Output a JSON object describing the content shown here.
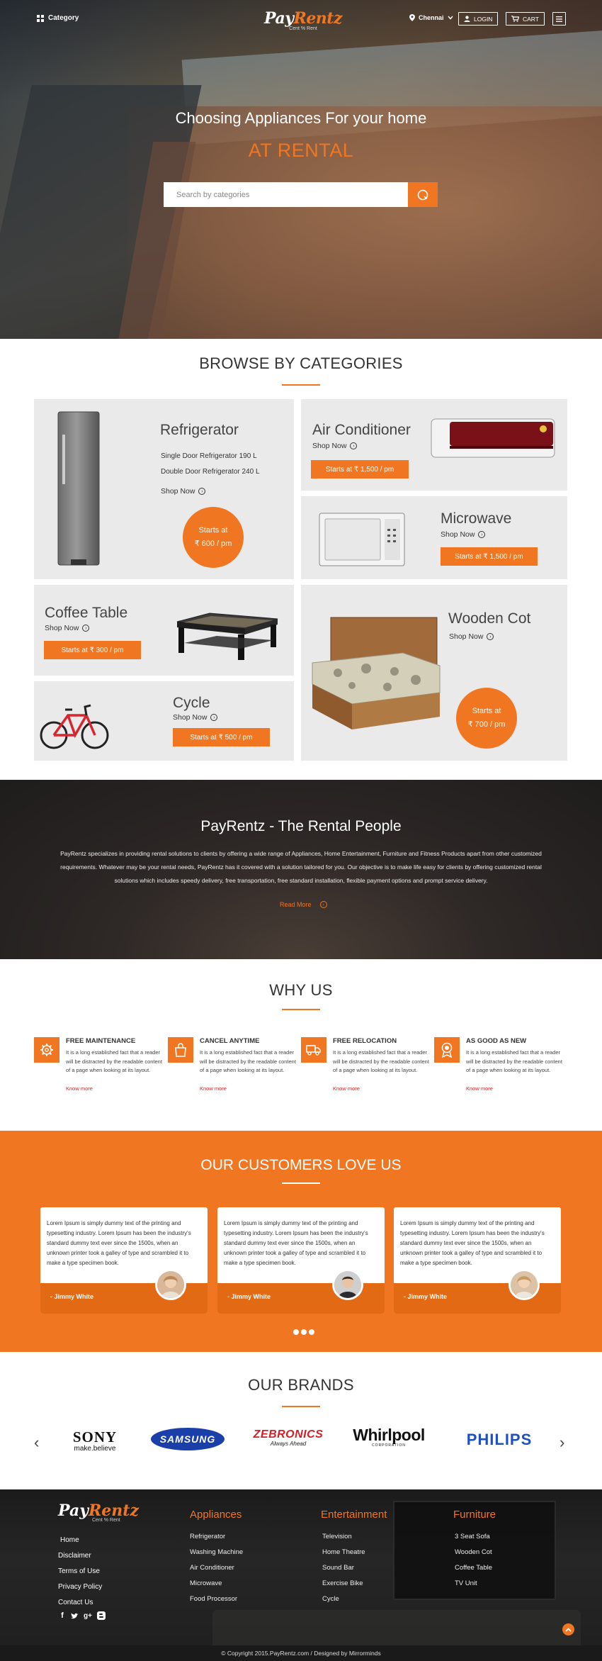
{
  "header": {
    "category_label": "Category",
    "logo_pay": "Pay",
    "logo_rentz": "Rentz",
    "logo_tagline": "Cent % Rent",
    "city": "Chennai",
    "login_label": "LOGIN",
    "cart_label": "CART"
  },
  "hero": {
    "title": "Choosing Appliances For your home",
    "subtitle": "AT RENTAL",
    "search_placeholder": "Search by categories"
  },
  "categories": {
    "title": "BROWSE BY CATEGORIES",
    "shop_now": "Shop Now",
    "refrigerator": {
      "name": "Refrigerator",
      "item1": "Single Door Refrigerator 190 L",
      "item2": "Double Door Refrigerator 240 L",
      "price_line1": "Starts at",
      "price_line2": "₹ 600 / pm"
    },
    "air_conditioner": {
      "name": "Air Conditioner",
      "price": "Starts at ₹ 1,500 / pm"
    },
    "microwave": {
      "name": "Microwave",
      "price": "Starts at ₹ 1,500 / pm"
    },
    "coffee_table": {
      "name": "Coffee Table",
      "price": "Starts at ₹ 300 / pm"
    },
    "wooden_cot": {
      "name": "Wooden Cot",
      "price_line1": "Starts at",
      "price_line2": "₹ 700 / pm"
    },
    "cycle": {
      "name": "Cycle",
      "price": "Starts at ₹ 500 / pm"
    }
  },
  "about": {
    "title": "PayRentz - The Rental People",
    "text": "PayRentz specializes in providing rental solutions to clients by offering a wide range of Appliances, Home Entertainment, Furniture and Fitness Products apart from other customized requirements. Whatever may be your rental needs, PayRentz has it covered with a solution tailored for you. Our objective is to make life easy for clients by offering customized rental solutions which includes speedy delivery, free transportation, free standard installation, flexible payment options and prompt service delivery.",
    "read_more": "Read More"
  },
  "why_us": {
    "title": "WHY US",
    "know_more": "Know more",
    "body": "It is a long established fact that a reader will be distracted by the readable content of a page when looking at its layout.",
    "items": [
      {
        "title": "FREE MAINTENANCE",
        "icon": "gear-icon"
      },
      {
        "title": "CANCEL ANYTIME",
        "icon": "bag-icon"
      },
      {
        "title": "FREE RELOCATION",
        "icon": "truck-icon"
      },
      {
        "title": "AS GOOD AS NEW",
        "icon": "badge-icon"
      }
    ]
  },
  "testimonials": {
    "title": "OUR CUSTOMERS LOVE US",
    "items": [
      {
        "text": "Lorem Ipsum is simply dummy text of the printing and typesetting industry. Lorem Ipsum has been the industry's standard dummy text ever since the 1500s, when an unknown printer took a galley of type and scrambled it to make a type specimen book.",
        "name": "- Jimmy White"
      },
      {
        "text": "Lorem Ipsum is simply dummy text of the printing and typesetting industry. Lorem Ipsum has been the industry's standard dummy text ever since the 1500s, when an unknown printer took a galley of type and scrambled it to make a type specimen book.",
        "name": "- Jimmy White"
      },
      {
        "text": "Lorem Ipsum is simply dummy text of the printing and typesetting industry. Lorem Ipsum has been the industry's standard dummy text ever since the 1500s, when an unknown printer took a galley of type and scrambled it to make a type specimen book.",
        "name": "- Jimmy White"
      }
    ]
  },
  "brands": {
    "title": "OUR BRANDS",
    "sony": "SONY",
    "sony_tag": "make.believe",
    "samsung": "SAMSUNG",
    "zebronics": "ZEBRONICS",
    "zebronics_tag": "Always Ahead",
    "whirlpool": "Whirlpool",
    "whirlpool_tag": "CORPORATION",
    "philips": "PHILIPS"
  },
  "footer": {
    "nav": [
      "Home",
      "Disclaimer",
      "Terms of Use",
      "Privacy Policy",
      "Contact Us"
    ],
    "appliances": {
      "title": "Appliances",
      "items": [
        "Refrigerator",
        "Washing Machine",
        "Air Conditioner",
        "Microwave",
        "Food Processor"
      ]
    },
    "entertainment": {
      "title": "Entertainment",
      "items": [
        "Television",
        "Home Theatre",
        "Sound Bar",
        "Exercise Bike",
        "Cycle"
      ]
    },
    "furniture": {
      "title": "Furniture",
      "items": [
        "3 Seat Sofa",
        "Wooden Cot",
        "Coffee Table",
        "TV Unit"
      ]
    },
    "copyright": "© Copyright 2015.PayRentz.com / Designed by Mirrorminds"
  },
  "colors": {
    "accent": "#f07622",
    "card_bg": "#eaeaea"
  }
}
